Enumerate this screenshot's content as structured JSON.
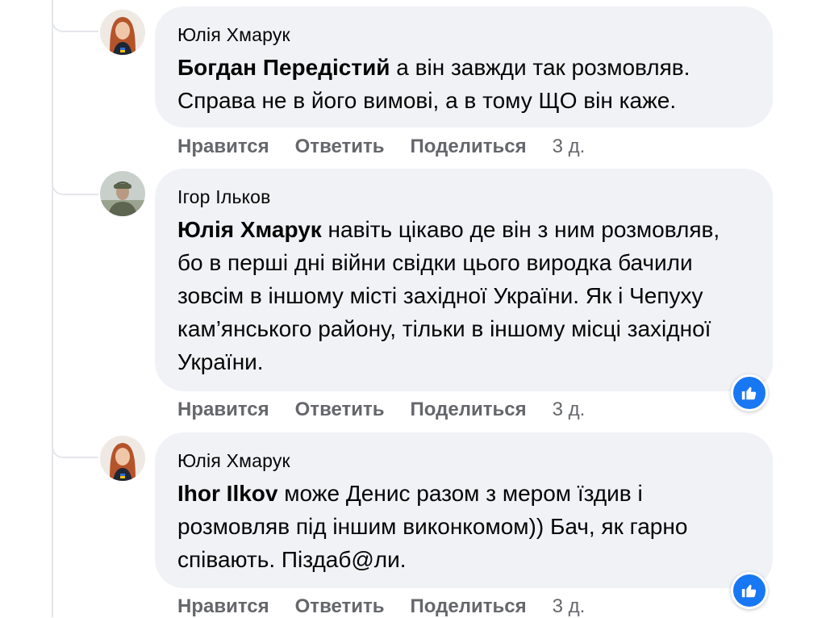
{
  "comments": [
    {
      "author": "Юлія Хмарук",
      "mention": "Богдан Передістий",
      "text": " а він завжди так розмовляв. Справа не в його вимові, а в тому ЩО він каже.",
      "actions": {
        "like": "Нравится",
        "reply": "Ответить",
        "share": "Поделиться",
        "time": "3 д."
      },
      "avatar_icon": "woman-avatar-icon"
    },
    {
      "author": "Ігор Ільков",
      "mention": "Юлія Хмарук",
      "text": " навіть цікаво де він з ним розмовляв, бо в перші дні війни свідки цього виродка бачили зовсім в іншому місті західної України. Як і Чепуху кам’янського району, тільки в іншому місці західної України.",
      "actions": {
        "like": "Нравится",
        "reply": "Ответить",
        "share": "Поделиться",
        "time": "3 д."
      },
      "avatar_icon": "soldier-avatar-icon",
      "reaction_icon": "like-thumb-icon"
    },
    {
      "author": "Юлія Хмарук",
      "mention": "Ihor Ilkov",
      "text": " може Денис разом з мером їздив і розмовляв під іншим виконкомом)) Бач, як гарно співають. Піздаб@ли.",
      "actions": {
        "like": "Нравится",
        "reply": "Ответить",
        "share": "Поделиться",
        "time": "3 д."
      },
      "avatar_icon": "woman-avatar-icon",
      "reaction_icon": "like-thumb-icon"
    }
  ],
  "colors": {
    "bubble": "#f0f2f5",
    "action_text": "#65676b",
    "like_blue": "#1877f2"
  }
}
